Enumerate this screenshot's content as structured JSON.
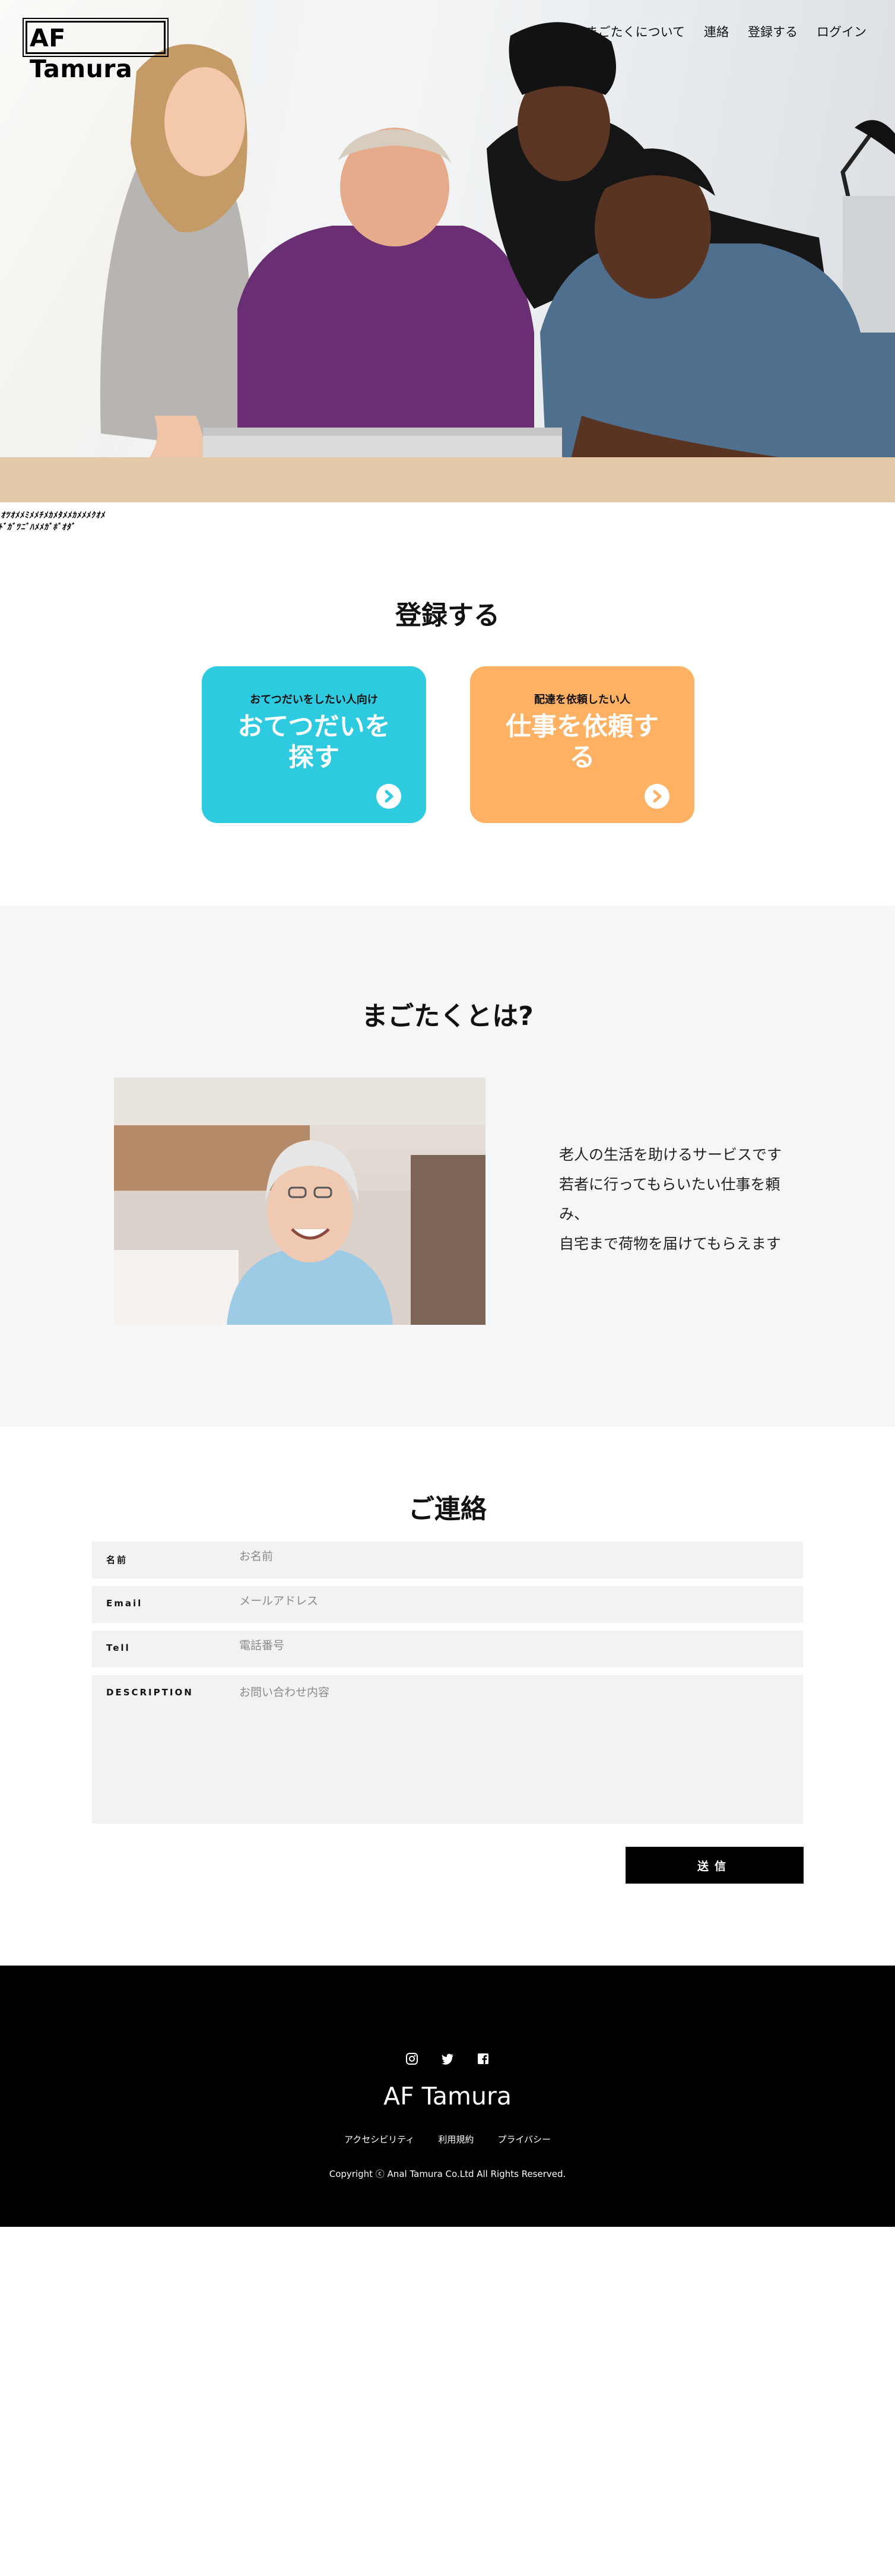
{
  "header": {
    "logo": "AF Tamura",
    "nav": [
      "まごたくについて",
      "連絡",
      "登録する",
      "ログイン"
    ]
  },
  "hero": {
    "image_alt": "four people looking at a laptop",
    "glyph_text": "ｵﾂｵﾒﾒﾐﾒﾒﾁﾒｶﾒﾀﾒﾒｶﾒﾒﾒｸｵﾒﾄﾞｶﾞﾂﾆﾞﾊﾒﾒｶﾞﾎﾞｵﾀﾞ"
  },
  "register": {
    "title": "登録する",
    "cards": [
      {
        "subtitle": "おてつだいをしたい人向け",
        "title": "おてつだいを探す",
        "color": "#2ecbe0"
      },
      {
        "subtitle": "配達を依頼したい人",
        "title": "仕事を依頼する",
        "color": "#feb162"
      }
    ]
  },
  "about": {
    "title": "まごたくとは?",
    "lines": [
      "老人の生活を助けるサービスです",
      "若者に行ってもらいたい仕事を頼み、",
      "自宅まで荷物を届けてもらえます"
    ]
  },
  "contact": {
    "title": "ご連絡",
    "fields": [
      {
        "label": "名前",
        "placeholder": "お名前"
      },
      {
        "label": "Email",
        "placeholder": "メールアドレス"
      },
      {
        "label": "Tell",
        "placeholder": "電話番号"
      },
      {
        "label": "DESCRIPTION",
        "placeholder": "お問い合わせ内容"
      }
    ],
    "submit": "送信"
  },
  "footer": {
    "social": [
      "instagram-icon",
      "twitter-icon",
      "facebook-icon"
    ],
    "brand": "AF Tamura",
    "links": [
      "アクセシビリティ",
      "利用規約",
      "プライバシー"
    ],
    "copyright": "Copyright ⓒ Anal Tamura Co.Ltd All Rights Reserved."
  }
}
